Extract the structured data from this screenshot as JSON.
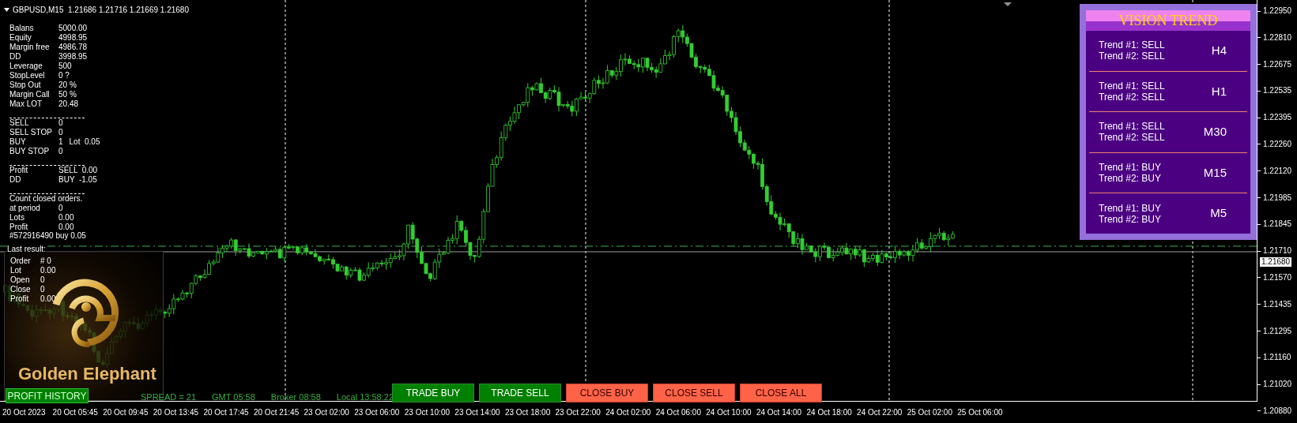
{
  "chart": {
    "title": "GBPUSD,M15  1.21686 1.21716 1.21669 1.21680"
  },
  "account_panel": {
    "lines": [
      {
        "kind": "row",
        "cells": [
          "Balans",
          "5000.00"
        ]
      },
      {
        "kind": "row",
        "cells": [
          "Equity",
          "4998.95"
        ]
      },
      {
        "kind": "row",
        "cells": [
          "Margin free",
          "4986.78"
        ]
      },
      {
        "kind": "row",
        "cells": [
          "DD",
          "3998.95"
        ]
      },
      {
        "kind": "row",
        "cells": [
          "Leverage",
          "500"
        ]
      },
      {
        "kind": "row",
        "cells": [
          "StopLevel",
          "0 ?"
        ]
      },
      {
        "kind": "row",
        "cells": [
          "Stop Out",
          "20 %"
        ]
      },
      {
        "kind": "row",
        "cells": [
          "Margin Call",
          "50 %"
        ]
      },
      {
        "kind": "row",
        "cells": [
          "Max LOT",
          "20.48"
        ]
      },
      {
        "kind": "separator"
      },
      {
        "kind": "row",
        "cells": [
          "SELL",
          "0"
        ]
      },
      {
        "kind": "row",
        "cells": [
          "SELL STOP",
          "0"
        ]
      },
      {
        "kind": "row",
        "cells": [
          "BUY",
          "1",
          "Lot  0.05"
        ]
      },
      {
        "kind": "row",
        "cells": [
          "BUY STOP",
          "0"
        ]
      },
      {
        "kind": "separator"
      },
      {
        "kind": "row",
        "cells": [
          "Profit",
          "SELL  0.00"
        ]
      },
      {
        "kind": "row",
        "cells": [
          "DD",
          "BUY  -1.05"
        ]
      },
      {
        "kind": "separator"
      },
      {
        "kind": "row",
        "cells": [
          "Count closed orders."
        ]
      },
      {
        "kind": "row",
        "cells": [
          "at period",
          "0"
        ]
      },
      {
        "kind": "row",
        "cells": [
          "Lots",
          "0.00"
        ]
      },
      {
        "kind": "row",
        "cells": [
          "Profit",
          "0.00"
        ]
      }
    ],
    "last_trade": "#572916490 buy 0.05"
  },
  "result_panel": {
    "title": "Last result:",
    "lines": [
      {
        "label": "Order",
        "value": "# 0"
      },
      {
        "label": "Lot",
        "value": "0.00"
      },
      {
        "label": "Open",
        "value": "0"
      },
      {
        "label": "Close",
        "value": "0"
      },
      {
        "label": "Profit",
        "value": "0.00"
      }
    ],
    "logo_text": "Golden Elephant"
  },
  "profit_history_button": "PROFIT HISTORY",
  "status": [
    "SPREAD = 21",
    "GMT 05:58",
    "Broker 08:58",
    "Local 13:58:22"
  ],
  "trade_buttons": [
    {
      "label": "TRADE BUY",
      "kind": "trade"
    },
    {
      "label": "TRADE SELL",
      "kind": "trade"
    },
    {
      "label": "CLOSE BUY",
      "kind": "close"
    },
    {
      "label": "CLOSE SELL",
      "kind": "close"
    },
    {
      "label": "CLOSE ALL",
      "kind": "close"
    }
  ],
  "vision_trend": {
    "title": "VISION TREND",
    "rows": [
      {
        "trend_1": "Trend #1: SELL",
        "trend_2": "Trend #2: SELL",
        "timeframe": "H4"
      },
      {
        "trend_1": "Trend #1: SELL",
        "trend_2": "Trend #2: SELL",
        "timeframe": "H1"
      },
      {
        "trend_1": "Trend #1: SELL",
        "trend_2": "Trend #2: SELL",
        "timeframe": "M30"
      },
      {
        "trend_1": "Trend #1: BUY",
        "trend_2": "Trend #2: BUY",
        "timeframe": "M15"
      },
      {
        "trend_1": "Trend #1: BUY",
        "trend_2": "Trend #2: BUY",
        "timeframe": "M5"
      }
    ]
  },
  "time_axis": [
    "20 Oct 2023",
    "20 Oct 05:45",
    "20 Oct 09:45",
    "20 Oct 13:45",
    "20 Oct 17:45",
    "20 Oct 21:45",
    "23 Oct 02:00",
    "23 Oct 06:00",
    "23 Oct 10:00",
    "23 Oct 14:00",
    "23 Oct 18:00",
    "23 Oct 22:00",
    "24 Oct 02:00",
    "24 Oct 06:00",
    "24 Oct 10:00",
    "24 Oct 14:00",
    "24 Oct 18:00",
    "24 Oct 22:00",
    "25 Oct 02:00",
    "25 Oct 06:00"
  ],
  "price_axis": [
    "1.22950",
    "1.22810",
    "1.22675",
    "1.22535",
    "1.22395",
    "1.22260",
    "1.22120",
    "1.21985",
    "1.21845",
    "1.21710",
    "1.21570",
    "1.21435",
    "1.21295",
    "1.21160",
    "1.21020",
    "1.20880"
  ],
  "current_price": "1.21680"
}
